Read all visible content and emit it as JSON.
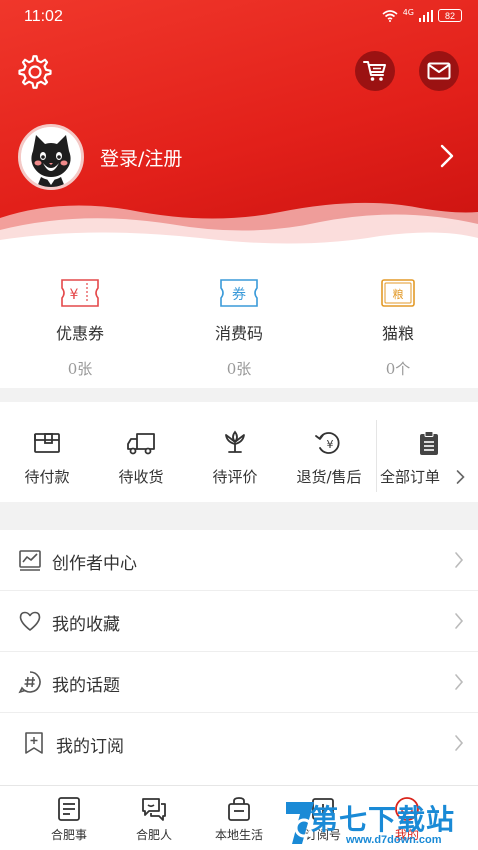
{
  "status_bar": {
    "time": "11:02",
    "network": "4G",
    "battery": "82"
  },
  "header": {
    "login_label": "登录/注册"
  },
  "wallet": {
    "items": [
      {
        "label": "优惠券",
        "count": "0张",
        "icon_text": "¥",
        "color": "#e4484a"
      },
      {
        "label": "消费码",
        "count": "0张",
        "icon_text": "券",
        "color": "#3a9ad9"
      },
      {
        "label": "猫粮",
        "count": "0个",
        "icon_text": "粮",
        "color": "#e39a28"
      }
    ]
  },
  "orders": {
    "items": [
      {
        "label": "待付款",
        "icon": "wallet-icon"
      },
      {
        "label": "待收货",
        "icon": "truck-icon"
      },
      {
        "label": "待评价",
        "icon": "flower-icon"
      },
      {
        "label": "退货/售后",
        "icon": "refund-icon"
      }
    ],
    "all_label": "全部订单"
  },
  "menu": {
    "items": [
      {
        "label": "创作者中心",
        "icon": "chart-icon"
      },
      {
        "label": "我的收藏",
        "icon": "heart-icon"
      },
      {
        "label": "我的话题",
        "icon": "hashtag-icon"
      },
      {
        "label": "我的订阅",
        "icon": "bookmark-plus-icon"
      }
    ]
  },
  "bottom_nav": {
    "items": [
      {
        "label": "合肥事",
        "icon": "document-icon"
      },
      {
        "label": "合肥人",
        "icon": "chat-icon"
      },
      {
        "label": "本地生活",
        "icon": "bag-icon"
      },
      {
        "label": "订阅号",
        "icon": "subscribe-icon"
      },
      {
        "label": "我的",
        "icon": "profile-icon",
        "active": true
      }
    ]
  },
  "watermark": {
    "text": "第七下载站",
    "url": "www.d7down.com"
  },
  "colors": {
    "brand_red": "#e2201a",
    "dark_red_button": "#9b1212",
    "active_nav": "#d9241b"
  }
}
